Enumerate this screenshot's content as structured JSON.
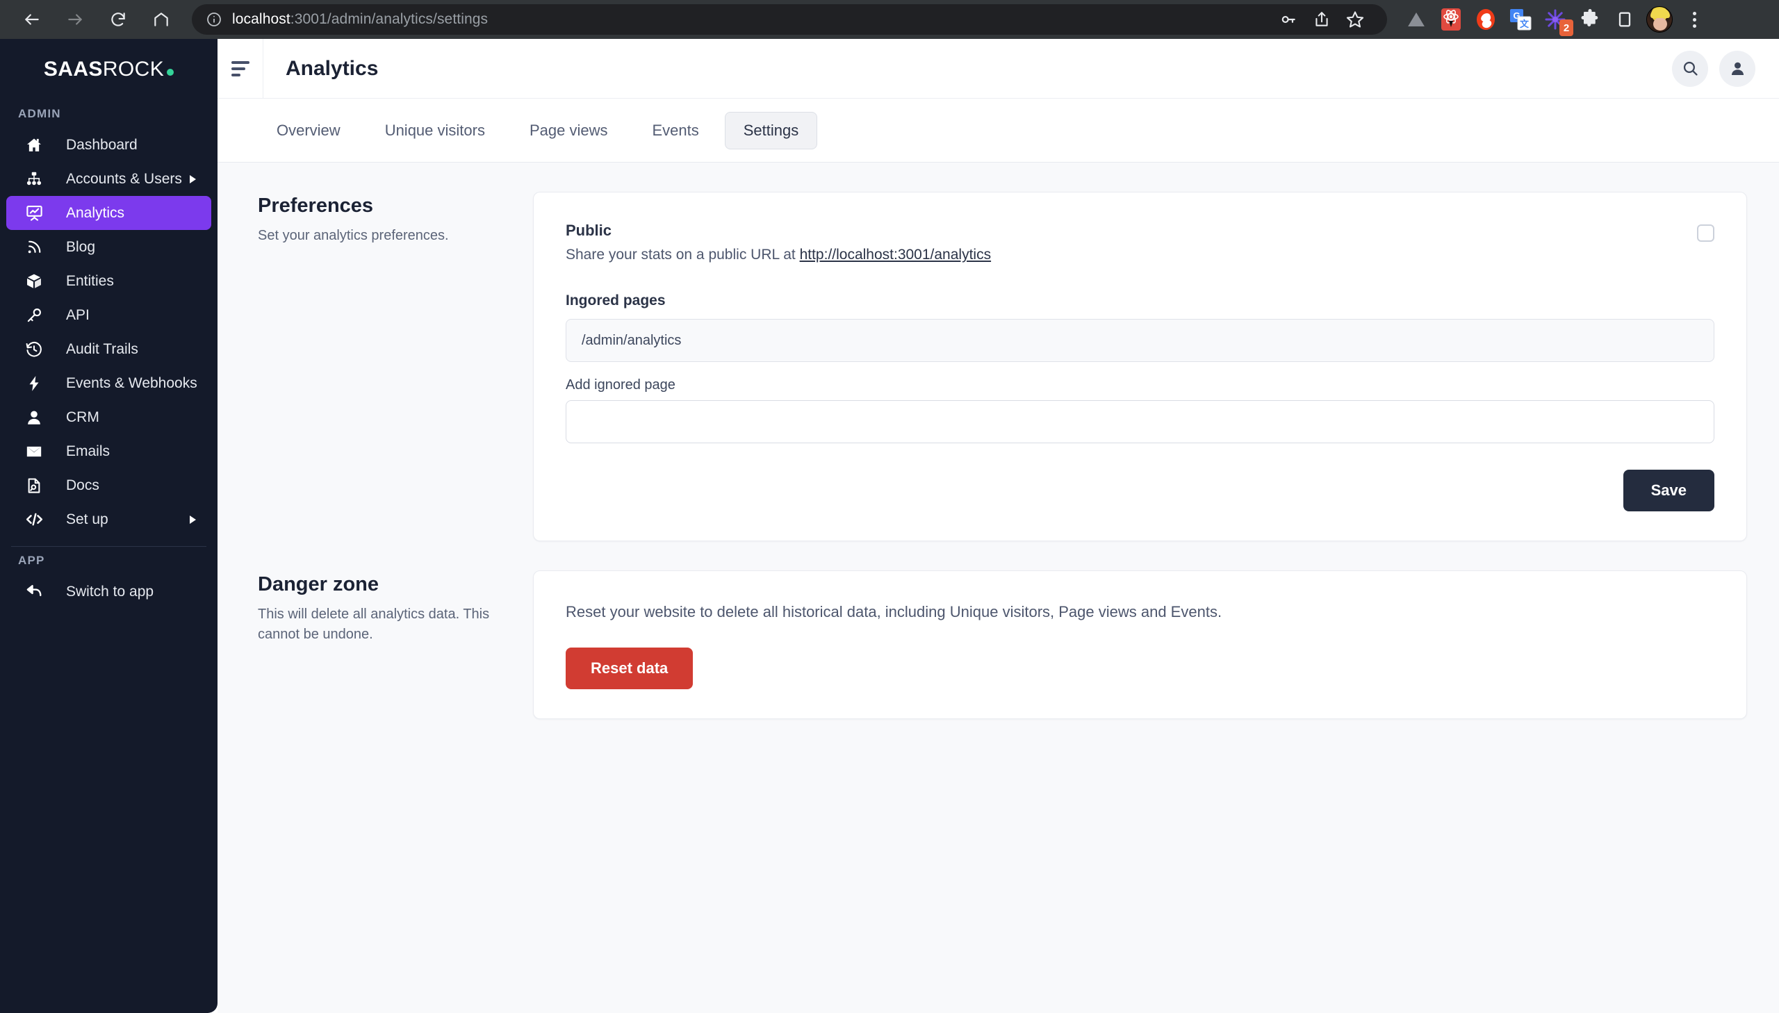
{
  "browser": {
    "url_host": "localhost",
    "url_path": ":3001/admin/analytics/settings",
    "back_icon": "back-arrow-icon",
    "forward_icon": "forward-arrow-icon",
    "reload_icon": "reload-icon",
    "home_icon": "home-icon",
    "info_icon": "site-info-icon",
    "password_icon": "key-icon",
    "share_icon": "share-icon",
    "bookmark_icon": "star-icon",
    "extensions": [
      {
        "name": "vercel-extension-icon",
        "badge": ""
      },
      {
        "name": "react-devtools-extension-icon",
        "badge": ""
      },
      {
        "name": "svelte-extension-icon",
        "badge": ""
      },
      {
        "name": "google-translate-extension-icon",
        "badge": ""
      },
      {
        "name": "starred-extension-icon",
        "badge": "2"
      },
      {
        "name": "puzzle-extensions-icon",
        "badge": ""
      },
      {
        "name": "side-panel-icon",
        "badge": ""
      }
    ],
    "profile_icon": "profile-avatar",
    "menu_icon": "kebab-menu-icon"
  },
  "sidebar": {
    "logo_bold": "SAAS",
    "logo_light": "ROCK",
    "logo_dot_color": "#34d399",
    "accent_color": "#7c3aed",
    "sections": [
      {
        "title": "ADMIN",
        "items": [
          {
            "label": "Dashboard",
            "icon": "home-icon",
            "active": false,
            "caret": false
          },
          {
            "label": "Accounts & Users",
            "icon": "org-chart-icon",
            "active": false,
            "caret": true
          },
          {
            "label": "Analytics",
            "icon": "presentation-chart-icon",
            "active": true,
            "caret": false
          },
          {
            "label": "Blog",
            "icon": "rss-icon",
            "active": false,
            "caret": false
          },
          {
            "label": "Entities",
            "icon": "cube-icon",
            "active": false,
            "caret": false
          },
          {
            "label": "API",
            "icon": "key-icon",
            "active": false,
            "caret": false
          },
          {
            "label": "Audit Trails",
            "icon": "clock-history-icon",
            "active": false,
            "caret": false
          },
          {
            "label": "Events & Webhooks",
            "icon": "lightning-bolt-icon",
            "active": false,
            "caret": false
          },
          {
            "label": "CRM",
            "icon": "user-icon",
            "active": false,
            "caret": false
          },
          {
            "label": "Emails",
            "icon": "envelope-icon",
            "active": false,
            "caret": false
          },
          {
            "label": "Docs",
            "icon": "document-search-icon",
            "active": false,
            "caret": false
          },
          {
            "label": "Set up",
            "icon": "code-icon",
            "active": false,
            "caret": true
          }
        ]
      },
      {
        "title": "APP",
        "items": [
          {
            "label": "Switch to app",
            "icon": "reply-arrow-icon",
            "active": false,
            "caret": false
          }
        ]
      }
    ]
  },
  "topbar": {
    "menu_icon": "hamburger-menu-icon",
    "title": "Analytics",
    "search_icon": "search-icon",
    "account_icon": "user-circle-icon"
  },
  "tabs": [
    {
      "label": "Overview",
      "active": false
    },
    {
      "label": "Unique visitors",
      "active": false
    },
    {
      "label": "Page views",
      "active": false
    },
    {
      "label": "Events",
      "active": false
    },
    {
      "label": "Settings",
      "active": true
    }
  ],
  "preferences": {
    "title": "Preferences",
    "description": "Set your analytics preferences.",
    "public_title": "Public",
    "public_desc_prefix": "Share your stats on a public URL at ",
    "public_url": "http://localhost:3001/analytics",
    "public_checked": false,
    "ignored_label": "Ingored pages",
    "ignored_pages": [
      "/admin/analytics"
    ],
    "add_label": "Add ignored page",
    "add_value": "",
    "add_placeholder": "",
    "save_label": "Save"
  },
  "danger": {
    "title": "Danger zone",
    "description": "This will delete all analytics data. This cannot be undone.",
    "card_text": "Reset your website to delete all historical data, including Unique visitors, Page views and Events.",
    "reset_label": "Reset data",
    "reset_color": "#d13c32"
  }
}
